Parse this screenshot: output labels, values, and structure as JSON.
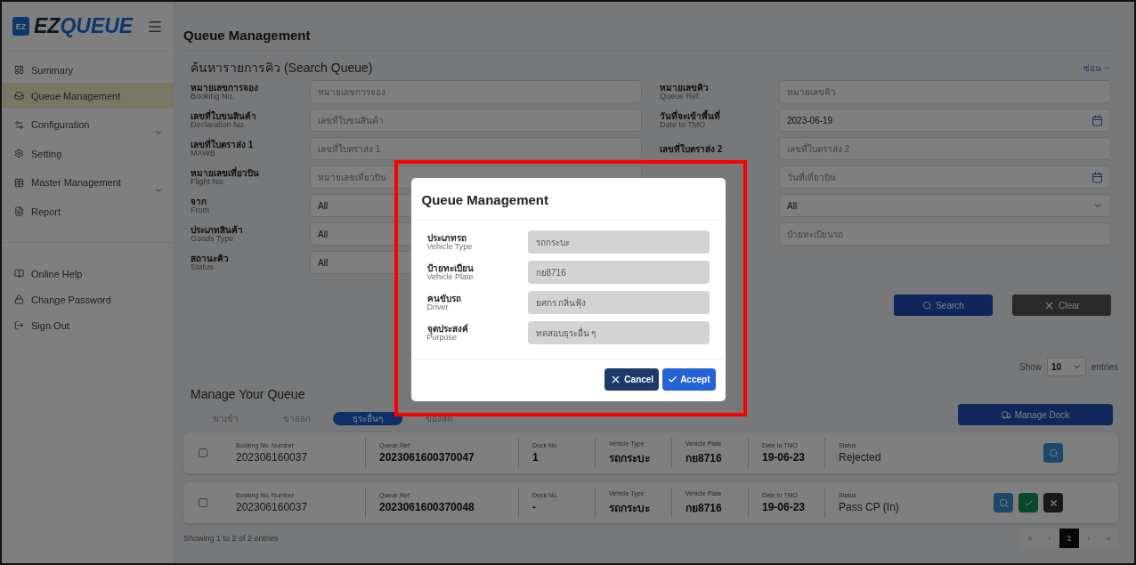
{
  "logo": {
    "badge": "EZ",
    "word_a": "EZ",
    "word_b": "QUEUE"
  },
  "sidebar": {
    "items": [
      {
        "label": "Summary",
        "selected": false,
        "expandable": false
      },
      {
        "label": "Queue Management",
        "selected": true,
        "expandable": false
      },
      {
        "label": "Configuration",
        "selected": false,
        "expandable": true
      },
      {
        "label": "Setting",
        "selected": false,
        "expandable": false
      },
      {
        "label": "Master Management",
        "selected": false,
        "expandable": true
      },
      {
        "label": "Report",
        "selected": false,
        "expandable": false
      }
    ],
    "bottom_items": [
      {
        "label": "Online Help"
      },
      {
        "label": "Change Password"
      },
      {
        "label": "Sign Out"
      }
    ]
  },
  "page_title": "Queue Management",
  "search": {
    "title": "ค้นหารายการคิว (Search Queue)",
    "collapse_link": "ซ่อน",
    "left_fields": [
      {
        "label": "หมายเลขการจอง",
        "sub": "Booking No.",
        "kind": "text",
        "placeholder": "หมายเลขการจอง"
      },
      {
        "label": "เลขที่ใบขนสินค้า",
        "sub": "Declaration No.",
        "kind": "text",
        "placeholder": "เลขที่ใบขนสินค้า"
      },
      {
        "label": "เลขที่ใบตราส่ง 1",
        "sub": "MAWB",
        "kind": "text",
        "placeholder": "เลขที่ใบตราส่ง 1"
      },
      {
        "label": "หมายเลขเที่ยวบิน",
        "sub": "Flight No.",
        "kind": "text",
        "placeholder": "หมายเลขเที่ยวบิน"
      },
      {
        "label": "จาก",
        "sub": "From",
        "kind": "select",
        "value": "All"
      },
      {
        "label": "ประเภทสินค้า",
        "sub": "Goods Type",
        "kind": "select",
        "value": "All"
      },
      {
        "label": "สถานะคิว",
        "sub": "Status",
        "kind": "select",
        "value": "All"
      }
    ],
    "right_fields": [
      {
        "label": "หมายเลขคิว",
        "sub": "Queue Ref.",
        "kind": "text",
        "placeholder": "หมายเลขคิว"
      },
      {
        "label": "วันที่จะเข้าพื้นที่",
        "sub": "Date to TMO",
        "kind": "date",
        "value": "2023-06-19"
      },
      {
        "label": "เลขที่ใบตราส่ง 2",
        "kind": "text",
        "placeholder": "เลขที่ใบตราส่ง 2"
      },
      {
        "kind": "date",
        "placeholder": "วันที่เที่ยวบิน"
      },
      {
        "kind": "select",
        "value": "All"
      },
      {
        "kind": "text",
        "placeholder": "ป้ายทะเบียนรถ"
      }
    ],
    "buttons": [
      {
        "kind": "search",
        "label": "Search"
      },
      {
        "kind": "clear",
        "label": "Clear"
      }
    ]
  },
  "show_entries": {
    "before": "Show",
    "value": "10",
    "after": "entries"
  },
  "queue": {
    "title": "Manage Your Queue",
    "manage_dock": "Manage Dock",
    "tabs": [
      {
        "label": "ขาเข้า",
        "selected": false
      },
      {
        "label": "ขาออก",
        "selected": false
      },
      {
        "label": "ธุระอื่นๆ",
        "selected": true
      },
      {
        "label": "ของสด",
        "selected": false
      }
    ],
    "rows": [
      {
        "checked": false,
        "cells": [
          {
            "label": "Booking No. Number",
            "value": "202306160037"
          },
          {
            "label": "Queue Ref",
            "value": "2023061600370047"
          },
          {
            "label": "Dock No.",
            "value": "1"
          },
          {
            "label": "Vehicle Type",
            "value": "รถกระบะ"
          },
          {
            "label": "Vehicle Plate",
            "value": "กย8716"
          },
          {
            "label": "Date to TMO",
            "value": "19-06-23"
          },
          {
            "label": "Status",
            "value": "Rejected"
          }
        ],
        "actions": [
          {
            "kind": "view"
          }
        ]
      },
      {
        "checked": false,
        "cells": [
          {
            "label": "Booking No. Number",
            "value": "202306160037"
          },
          {
            "label": "Queue Ref",
            "value": "2023061600370048"
          },
          {
            "label": "Dock No.",
            "value": "-"
          },
          {
            "label": "Vehicle Type",
            "value": "รถกระบะ"
          },
          {
            "label": "Vehicle Plate",
            "value": "กย8716"
          },
          {
            "label": "Date to TMO",
            "value": "19-06-23"
          },
          {
            "label": "Status",
            "value": "Pass CP (In)"
          }
        ],
        "actions": [
          {
            "kind": "view"
          },
          {
            "kind": "approve"
          },
          {
            "kind": "reject"
          }
        ]
      }
    ],
    "footer": "Showing 1 to 2 of 2 entries",
    "pages": [
      {
        "label": "«",
        "selected": false
      },
      {
        "label": "‹",
        "selected": false
      },
      {
        "label": "1",
        "selected": true
      },
      {
        "label": "›",
        "selected": false
      },
      {
        "label": "»",
        "selected": false
      }
    ]
  },
  "modal": {
    "title": "Queue Management",
    "fields": [
      {
        "label": "ประเภทรถ",
        "sub": "Vehicle Type",
        "value": "รถกระบะ"
      },
      {
        "label": "ป้ายทะเบียน",
        "sub": "Vehicle Plate",
        "value": "กย8716"
      },
      {
        "label": "คนขับรถ",
        "sub": "Driver",
        "value": "ยศกร กลิ่นฟุ้ง"
      },
      {
        "label": "จุดประสงค์",
        "sub": "Purpose",
        "value": "ทดสอบธุระอื่น ๆ"
      }
    ],
    "buttons": [
      {
        "kind": "cancel",
        "label": "Cancel"
      },
      {
        "kind": "accept",
        "label": "Accept"
      }
    ]
  }
}
